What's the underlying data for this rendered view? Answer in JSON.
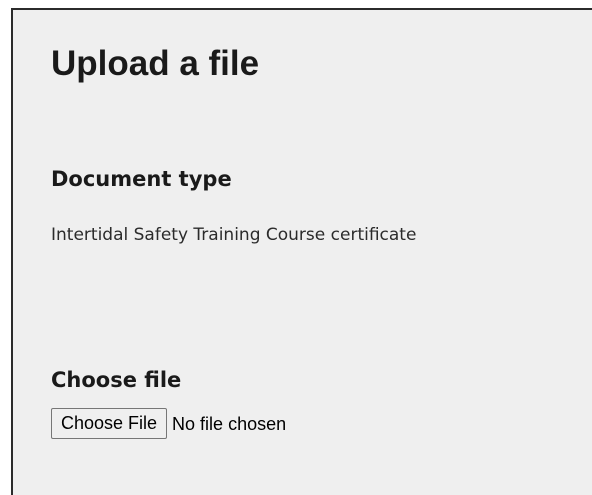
{
  "page": {
    "title": "Upload a file"
  },
  "document_type": {
    "heading": "Document type",
    "value": "Intertidal Safety Training Course certificate"
  },
  "file_upload": {
    "heading": "Choose file",
    "button_label": "Choose File",
    "status_text": "No file chosen"
  },
  "colors": {
    "panel_background": "#efefef",
    "panel_border": "#2b2b2b",
    "text": "#1a1a1a"
  }
}
